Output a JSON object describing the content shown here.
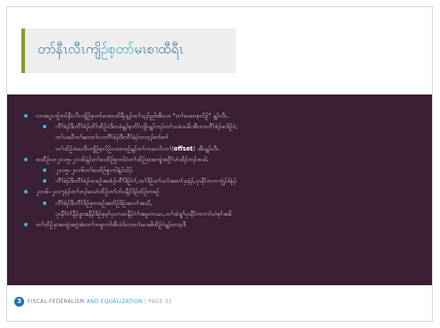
{
  "slide": {
    "title_a": "တာ်နီၤလီၤကျိ",
    "title_b": "ဉ်စ့တာ်",
    "title_c": "မၤစၢ",
    "title_d": "ထီရီၤ",
    "bullets": [
      {
        "level": 1,
        "text": "လၢအပူၤကွ်တာ်နီၤလီၤကျိဉ်စ့တာ်မၤစၢၤထိရီၤန့ၣ်တၢ်သ့ၣ်ညါအီၤလၢ \"တၢ်မၤစၢၤစ့လိဉ်\" န့ၣ်လီၤ."
      },
      {
        "level": 2,
        "text": "ကီၢ်စဲၣ်ဒီးကီၢ်စဲၣ်တိၢ်ထိဉ်ဝဲဒီတခဲန့ၣ်စ့ကိၢ်ကျိၤန့ၣ်ဘၣ်တၢ်သမံသမိးအီၤလၢကီၢ်စဲၣ်ဖးဒိဉ်ဝဲ,"
      },
      {
        "level": 3,
        "text": "တၢ်ပၢဃီတၢ်ဆၢတၢ်လၢကီၢ်စဲၣ်ဒီးကီၢ်ခဲၣ်တဘ့ၣ်စၢၢ်စၢၢ်"
      },
      {
        "level": 3,
        "text": "တၢ်ထိဉ်ဝဲမၤလီၤကျိဉ်စ့လိဉ်လၢတဖဉ်န့ၣ်တၢ်ကမၤလိးတၢ်(",
        "bold": "offset",
        "after": ") အီၤန့ၣ်လီၤ."
      },
      {
        "level": 1,
        "text": "စးထီဉ်လၢ၂၀၁၅–၂၀၁၆နံၣ်တၢ်စးထိဉ်စူးကါဝဲတၢ်ထိဉ်ဒုးအကျဲအဂ္ဂီၢ်ဟဲအိၣ်ဘၣ်တခါ."
      },
      {
        "level": 2,
        "text": "၂၀၁၅–၂၀၁၆တၢ်စးထိဉ်စူးကါနံၣ်သိၣ်"
      },
      {
        "level": 2,
        "text": "ကီၢ်စဲၣ်ဒီးကီၢ်ခဲၣ်တဖဉ်အထံၣ်ကီၢ်ဒိဉ်ဂံၢ်,တၢ်ဒိဉ်တၢ်ယၢ်အတၢ်ဒုးနဲၣ်,ပုၤနီၢ်တကကွဲၣ်ဒ်နံၣ်"
      },
      {
        "level": 1,
        "text": "၂၀၁၆–၂၀၁၇နံၣ်တၢ်ဘၣ်မၤဟဲထိဉ်တၢ်ပာ်ပနီၣ်ဒိဉ်ထိဉ်တဖဉ်"
      },
      {
        "level": 2,
        "text": "ကီၢ်စဲၣ်ဒီးကီၢ်ဒိဉ်ဖုတဖဉ်အတိဉ်ဒိဉ်အလၢ်အသိ,"
      },
      {
        "level": 3,
        "text": "ပုၤနီၢ်ဂံၢ်နီၣ်ဒူးအနီၣ်ဒိဉ်ဖုမ့ၢ်ပုၤကမၤနီၣ်ဂံၢ်အမူးကယၤ,တၢ်ထဲရူၢ်ပုၤနီၢ်ကကၢၢ်ဟဲစုၢ်အခိ"
      },
      {
        "level": 1,
        "text": "တၢ်ထိဉ်ဒုးအကျဲအဂ္ဂဲအံၤတၢ်ကစူးကါအီၤဝဲဒ်လၢတၢ်မၤအါထိဉ်ဝဲန့ၣ်တသ့ဒီ"
      }
    ]
  },
  "footer": {
    "badge": "3",
    "text_a": "FISCAL FEDERALISM",
    "text_b": " AND EQUALIZATION",
    "page": " | PAGE 01"
  }
}
